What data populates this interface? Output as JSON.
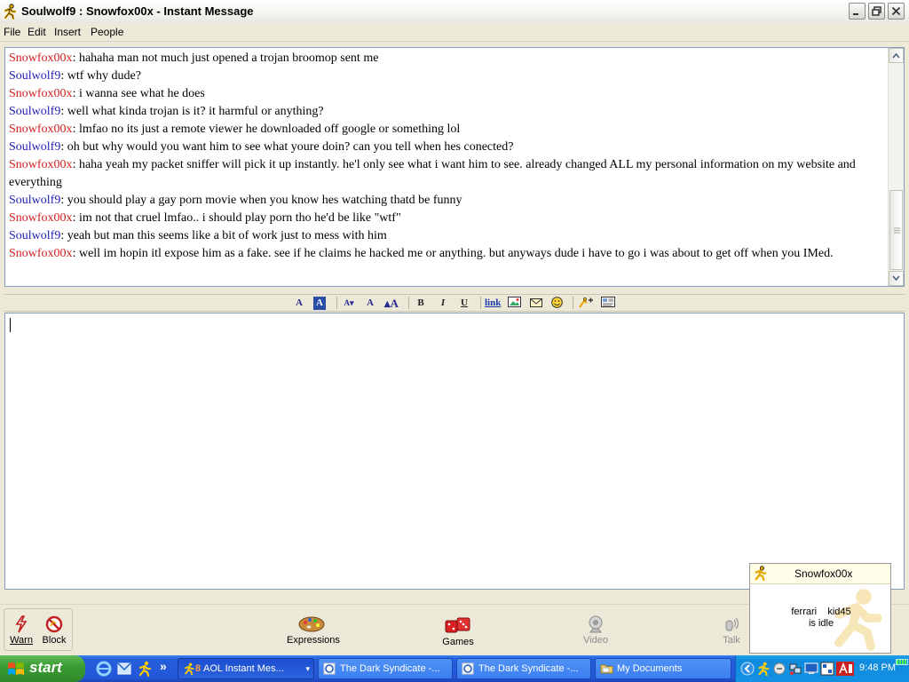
{
  "window": {
    "title": "Soulwolf9 : Snowfox00x - Instant Message"
  },
  "menu": [
    "File",
    "Edit",
    "Insert",
    "People"
  ],
  "colors": {
    "sender_red": "#d02020",
    "sender_blue": "#2020b8"
  },
  "conversation": [
    {
      "sender": "Snowfox00x",
      "color": "red",
      "text": "hahaha man not much just opened a trojan broomop sent me"
    },
    {
      "sender": "Soulwolf9",
      "color": "blue",
      "text": "wtf why dude?"
    },
    {
      "sender": "Snowfox00x",
      "color": "red",
      "text": "i wanna see what he does"
    },
    {
      "sender": "Soulwolf9",
      "color": "blue",
      "text": "well what kinda trojan is it? it harmful or anything?"
    },
    {
      "sender": "Snowfox00x",
      "color": "red",
      "text": "lmfao no its just a remote viewer he downloaded off google or something lol"
    },
    {
      "sender": "Soulwolf9",
      "color": "blue",
      "text": "oh but why would you want him to see what youre doin? can you tell when hes conected?"
    },
    {
      "sender": "Snowfox00x",
      "color": "red",
      "text": "haha yeah my packet sniffer will pick it up instantly. he'l only see what i want him to see. already changed ALL my personal information on my website and everything"
    },
    {
      "sender": "Soulwolf9",
      "color": "blue",
      "text": "you should play a gay porn movie when you know hes watching thatd be funny"
    },
    {
      "sender": "Snowfox00x",
      "color": "red",
      "text": "im not that cruel lmfao.. i should play porn tho he'd be like \"wtf\""
    },
    {
      "sender": "Soulwolf9",
      "color": "blue",
      "text": "yeah but man this seems like a bit of work just to mess with him"
    },
    {
      "sender": "Snowfox00x",
      "color": "red",
      "text": "well im hopin itl expose him as a fake. see if he claims he hacked me or anything. but anyways dude i have to go i was about to get off when you IMed."
    }
  ],
  "format_toolbar": {
    "link_label": "link",
    "bold": "B",
    "italic": "I",
    "underline": "U"
  },
  "input": {
    "value": ""
  },
  "bottom_actions": {
    "warn": "Warn",
    "block": "Block",
    "expressions": "Expressions",
    "games": "Games",
    "video": "Video",
    "talk": "Talk"
  },
  "notification": {
    "screen_name": "Snowfox00x",
    "buddy": "ferrari    kid45",
    "status": "is idle"
  },
  "taskbar": {
    "start_label": "start",
    "overflow": "»",
    "tasks": [
      {
        "label": "AOL Instant Mes...",
        "active": true
      },
      {
        "label": "The Dark Syndicate -...",
        "active": false
      },
      {
        "label": "The Dark Syndicate -...",
        "active": false
      },
      {
        "label": "My Documents",
        "active": false
      }
    ],
    "clock": "9:48 PM"
  }
}
